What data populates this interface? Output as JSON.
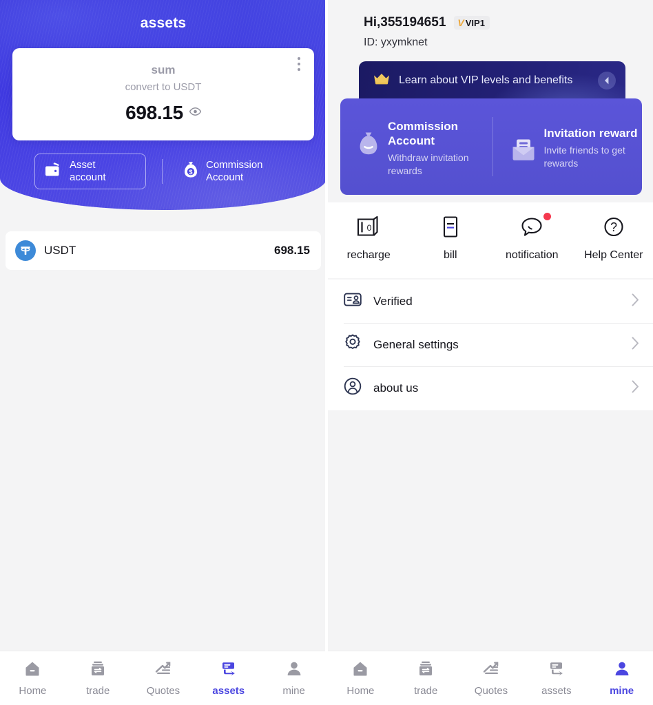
{
  "left_panel": {
    "header_title": "assets",
    "balance_card": {
      "sum_label": "sum",
      "convert_label": "convert to USDT",
      "amount": "698.15",
      "menu_icon": "more-vertical-icon",
      "eye_icon": "eye-visible-icon"
    },
    "account_buttons": [
      {
        "label_line1": "Asset",
        "label_line2": "account",
        "icon": "wallet-icon"
      },
      {
        "label_line1": "Commission",
        "label_line2": "Account",
        "icon": "money-bag-icon"
      }
    ],
    "coin_list": [
      {
        "symbol": "USDT",
        "amount": "698.15",
        "icon": "tether-icon",
        "icon_color": "#3d8ad8"
      }
    ]
  },
  "right_panel": {
    "greeting": "Hi,355194651",
    "vip_badge": {
      "mark": "V",
      "level": "VIP1"
    },
    "user_id": "ID: yxymknet",
    "vip_banner": {
      "text": "Learn about VIP levels and benefits",
      "crown_icon": "crown-icon",
      "arrow_icon": "chevron-left-circle-icon"
    },
    "promo_cards": [
      {
        "title": "Commission Account",
        "subtitle": "Withdraw invitation rewards",
        "icon": "money-bag-icon"
      },
      {
        "title": "Invitation reward",
        "subtitle": "Invite friends to get rewards",
        "icon": "envelope-icon"
      }
    ],
    "quick_actions": [
      {
        "label": "recharge",
        "icon": "recharge-card-icon",
        "badge": false
      },
      {
        "label": "bill",
        "icon": "bill-document-icon",
        "badge": false
      },
      {
        "label": "notification",
        "icon": "chat-bubble-icon",
        "badge": true
      },
      {
        "label": "Help Center",
        "icon": "question-circle-icon",
        "badge": false
      }
    ],
    "menu_items": [
      {
        "label": "Verified",
        "icon": "id-card-icon"
      },
      {
        "label": "General settings",
        "icon": "gear-icon"
      },
      {
        "label": "about us",
        "icon": "user-circle-icon"
      }
    ]
  },
  "tabbar_left": {
    "items": [
      {
        "label": "Home",
        "icon": "home-icon",
        "active": false
      },
      {
        "label": "trade",
        "icon": "trade-icon",
        "active": false
      },
      {
        "label": "Quotes",
        "icon": "quotes-chart-icon",
        "active": false
      },
      {
        "label": "assets",
        "icon": "assets-card-icon",
        "active": true
      },
      {
        "label": "mine",
        "icon": "person-icon",
        "active": false
      }
    ]
  },
  "tabbar_right": {
    "items": [
      {
        "label": "Home",
        "icon": "home-icon",
        "active": false
      },
      {
        "label": "trade",
        "icon": "trade-icon",
        "active": false
      },
      {
        "label": "Quotes",
        "icon": "quotes-chart-icon",
        "active": false
      },
      {
        "label": "assets",
        "icon": "assets-card-icon",
        "active": false
      },
      {
        "label": "mine",
        "icon": "person-icon",
        "active": true
      }
    ]
  },
  "colors": {
    "brand_blue": "#4b46e0",
    "hero_blue": "#3e38e0",
    "promo_purple": "#5b55d9",
    "vip_navy": "#1b1a63",
    "vip_gold": "#eda83b",
    "badge_red": "#f5384e",
    "page_bg": "#f4f4f5",
    "inactive_gray": "#8a8a95"
  }
}
